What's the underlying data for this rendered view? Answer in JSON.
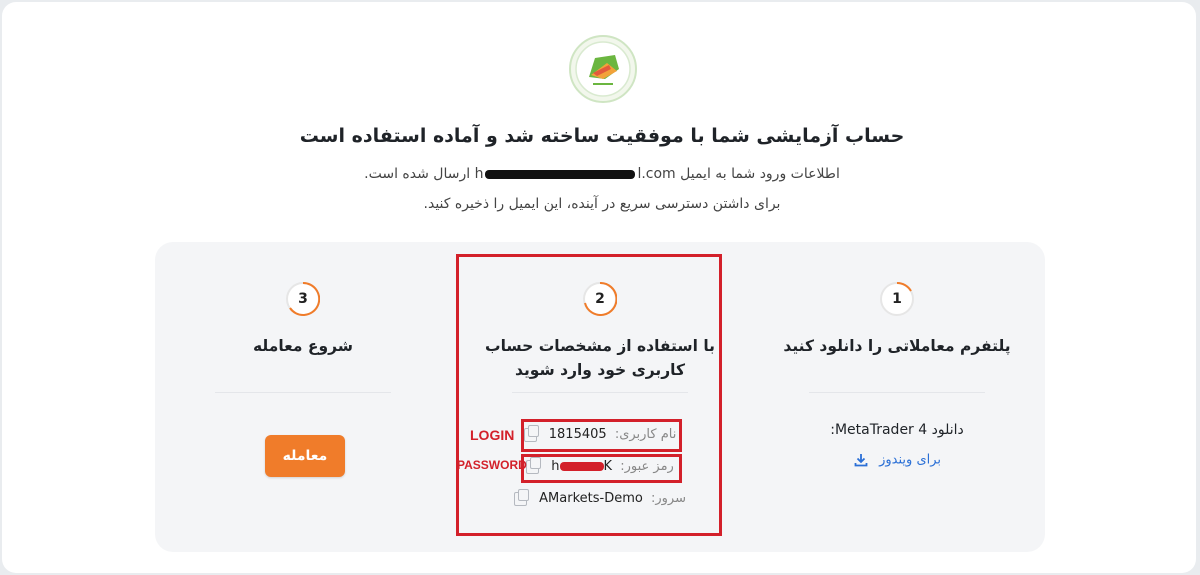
{
  "header": {
    "title": "حساب آزمایشی شما با موفقیت ساخته شد و آماده استفاده است",
    "email_line_prefix": "اطلاعات ورود شما به ایمیل",
    "email_visible_start": "h",
    "email_visible_end": "l.com",
    "email_line_suffix": "ارسال شده است.",
    "save_hint": "برای داشتن دسترسی سریع در آینده، این ایمیل را ذخیره کنید."
  },
  "steps": [
    {
      "number": "1",
      "title": "پلتفرم معاملاتی را دانلود کنید",
      "download_label": "دانلود MetaTrader 4:",
      "windows_link": "برای ویندوز"
    },
    {
      "number": "2",
      "title_line1": "با استفاده از مشخصات حساب",
      "title_line2": "کاربری خود وارد شوید",
      "username_key": "نام کاربری:",
      "username_value": "1815405",
      "password_key": "رمز عبور:",
      "password_visible_start": "h",
      "password_visible_end": "K",
      "server_key": "سرور:",
      "server_value": "AMarkets-Demo"
    },
    {
      "number": "3",
      "title": "شروع معامله",
      "button_label": "معامله"
    }
  ],
  "annotations": {
    "login": "LOGIN",
    "password": "PASSWORD"
  },
  "colors": {
    "accent": "#f07c2a",
    "link": "#2a6fd6",
    "annotation": "#d3202a"
  },
  "icons": {
    "logo": "brand-logo-icon",
    "copy": "copy-icon",
    "download": "download-icon"
  }
}
